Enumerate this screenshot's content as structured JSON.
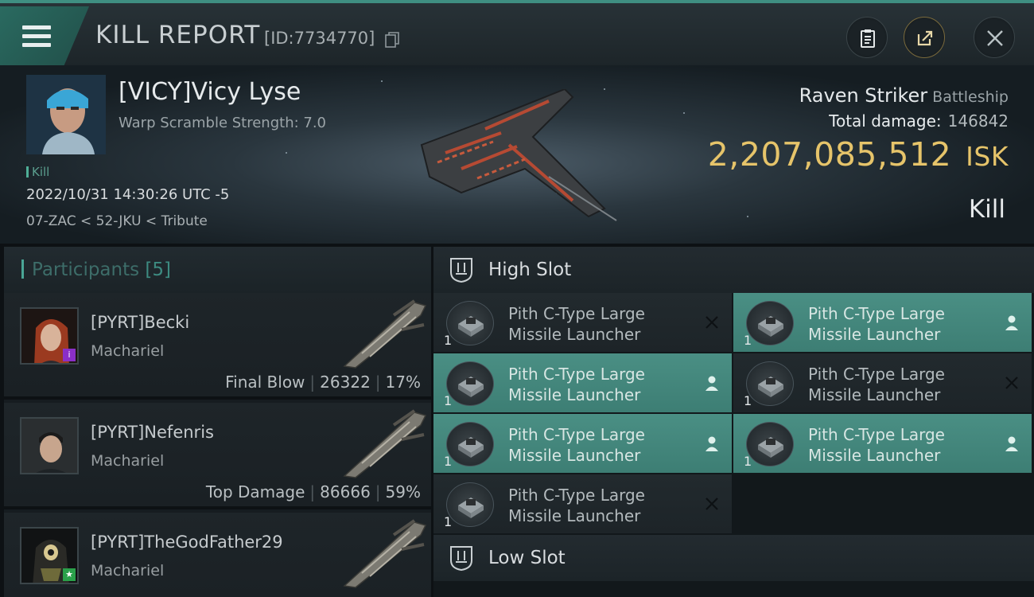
{
  "header": {
    "title": "KILL REPORT",
    "report_id": "[ID:7734770]",
    "menu_icon": "hamburger-menu-icon",
    "buttons": [
      "clipboard-icon",
      "share-icon",
      "close-icon"
    ]
  },
  "victim": {
    "name": "[VICY]Vicy Lyse",
    "subtitle": "Warp Scramble Strength: 7.0",
    "tag": "Kill",
    "datetime": "2022/10/31 14:30:26 UTC -5",
    "location": "07-ZAC < 52-JKU < Tribute",
    "ship_name": "Raven Striker",
    "ship_class": "Battleship",
    "total_damage_label": "Total damage:",
    "total_damage": "146842",
    "isk_value": "2,207,085,512",
    "isk_unit": "ISK",
    "result": "Kill"
  },
  "participants": {
    "label": "Participants",
    "count": "[5]",
    "rows": [
      {
        "name": "[PYRT]Becki",
        "ship": "Machariel",
        "role": "Final Blow",
        "damage": "26322",
        "percent": "17%"
      },
      {
        "name": "[PYRT]Nefenris",
        "ship": "Machariel",
        "role": "Top Damage",
        "damage": "86666",
        "percent": "59%"
      },
      {
        "name": "[PYRT]TheGodFather29",
        "ship": "Machariel",
        "role": "",
        "damage": "",
        "percent": ""
      }
    ]
  },
  "slots": {
    "high": {
      "label": "High Slot",
      "modules": [
        {
          "line1": "Pith C-Type Large",
          "line2": "Missile Launcher",
          "qty": "1",
          "status": "destroyed"
        },
        {
          "line1": "Pith C-Type Large",
          "line2": "Missile Launcher",
          "qty": "1",
          "status": "dropped"
        },
        {
          "line1": "Pith C-Type Large",
          "line2": "Missile Launcher",
          "qty": "1",
          "status": "dropped"
        },
        {
          "line1": "Pith C-Type Large",
          "line2": "Missile Launcher",
          "qty": "1",
          "status": "destroyed"
        },
        {
          "line1": "Pith C-Type Large",
          "line2": "Missile Launcher",
          "qty": "1",
          "status": "dropped"
        },
        {
          "line1": "Pith C-Type Large",
          "line2": "Missile Launcher",
          "qty": "1",
          "status": "dropped"
        },
        {
          "line1": "Pith C-Type Large",
          "line2": "Missile Launcher",
          "qty": "1",
          "status": "destroyed"
        }
      ]
    },
    "low": {
      "label": "Low Slot"
    }
  },
  "colors": {
    "accent_teal": "#4a8f84",
    "isk_gold": "#e6c46a",
    "background": "#12181b"
  }
}
